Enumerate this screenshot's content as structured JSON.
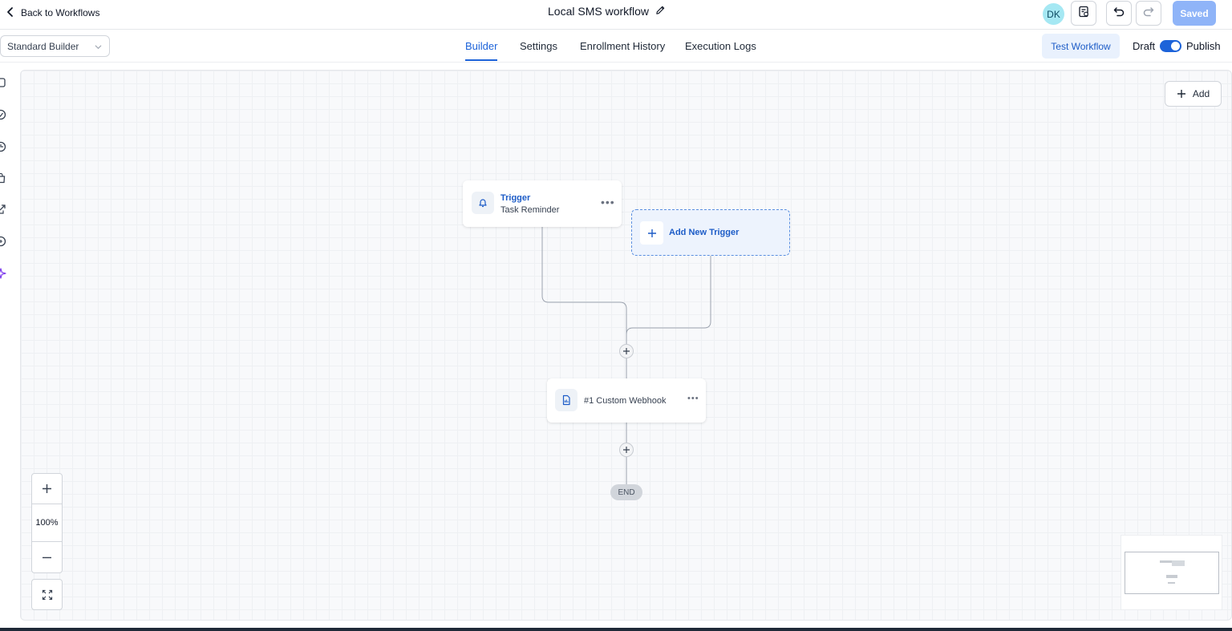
{
  "header": {
    "back_label": "Back to Workflows",
    "workflow_title": "Local SMS workflow",
    "avatar_initials": "DK",
    "saved_label": "Saved"
  },
  "subbar": {
    "builder_select_value": "Standard Builder",
    "tabs": [
      {
        "label": "Builder",
        "active": true
      },
      {
        "label": "Settings",
        "active": false
      },
      {
        "label": "Enrollment History",
        "active": false
      },
      {
        "label": "Execution Logs",
        "active": false
      }
    ],
    "test_workflow_label": "Test Workflow",
    "draft_label": "Draft",
    "publish_label": "Publish",
    "publish_toggle_on": true
  },
  "canvas": {
    "add_label": "Add",
    "trigger_node": {
      "title": "Trigger",
      "subtitle": "Task Reminder"
    },
    "add_trigger_label": "Add New Trigger",
    "action_node": {
      "title": "#1 Custom Webhook"
    },
    "end_label": "END",
    "zoom_level": "100%"
  },
  "colors": {
    "accent": "#1d63d9",
    "saved_button": "#8fb4f8",
    "avatar_bg": "#a5e8f3",
    "canvas_bg": "#f8f9fb"
  }
}
